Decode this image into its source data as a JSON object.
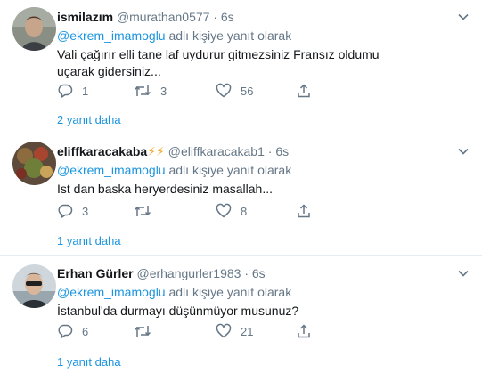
{
  "reply_prefix": "adlı kişiye yanıt olarak",
  "tweets": [
    {
      "name": "ismilazım",
      "badges": "",
      "handle": "@murathan0577",
      "time": "· 6s",
      "reply_to": "@ekrem_imamoglu",
      "text": "Vali çağırır elli tane laf uydurur gitmezsiniz Fransız oldumu uçarak gidersiniz...",
      "replies": "1",
      "retweets": "3",
      "likes": "56",
      "more": "2 yanıt daha"
    },
    {
      "name": "eliffkaracakaba",
      "badges": "⚡⚡",
      "handle": "@eliffkaracakab1",
      "time": "· 6s",
      "reply_to": "@ekrem_imamoglu",
      "text": "Ist dan baska heryerdesiniz masallah...",
      "replies": "3",
      "retweets": "",
      "likes": "8",
      "more": "1 yanıt daha"
    },
    {
      "name": "Erhan Gürler",
      "badges": "",
      "handle": "@erhangurler1983",
      "time": "· 6s",
      "reply_to": "@ekrem_imamoglu",
      "text": "İstanbul'da durmayı düşünmüyor musunuz?",
      "replies": "6",
      "retweets": "",
      "likes": "21",
      "more": "1 yanıt daha"
    }
  ],
  "colors": {
    "link": "#1b95e0",
    "muted": "#657786",
    "badge": "#f5a623"
  }
}
